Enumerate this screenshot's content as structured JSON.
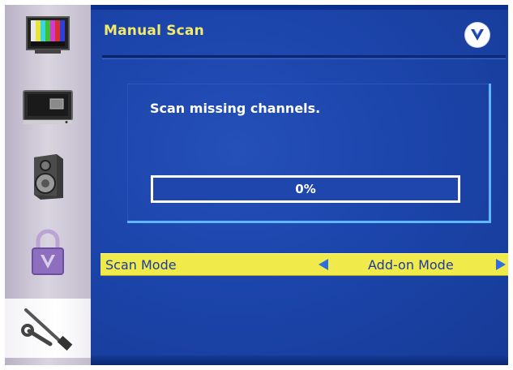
{
  "menu": {
    "title": "Manual Scan",
    "brand_icon": "vizio-v-logo"
  },
  "sidebar": {
    "items": [
      {
        "icon": "tv-color-bars-icon",
        "selected": false
      },
      {
        "icon": "tv-monitor-icon",
        "selected": false
      },
      {
        "icon": "speaker-icon",
        "selected": false
      },
      {
        "icon": "padlock-icon",
        "selected": false
      },
      {
        "icon": "wrench-screwdriver-icon",
        "selected": true
      }
    ]
  },
  "scan": {
    "message": "Scan missing channels.",
    "progress_text": "0%",
    "progress_value": 0
  },
  "scan_mode": {
    "label": "Scan Mode",
    "value": "Add-on Mode"
  },
  "colors": {
    "title": "#f1ea6b",
    "panel": "#1c45ab",
    "highlight_row": "#f0ea4a",
    "arrow": "#2f6de0",
    "box_border": "#5fb7ff"
  }
}
